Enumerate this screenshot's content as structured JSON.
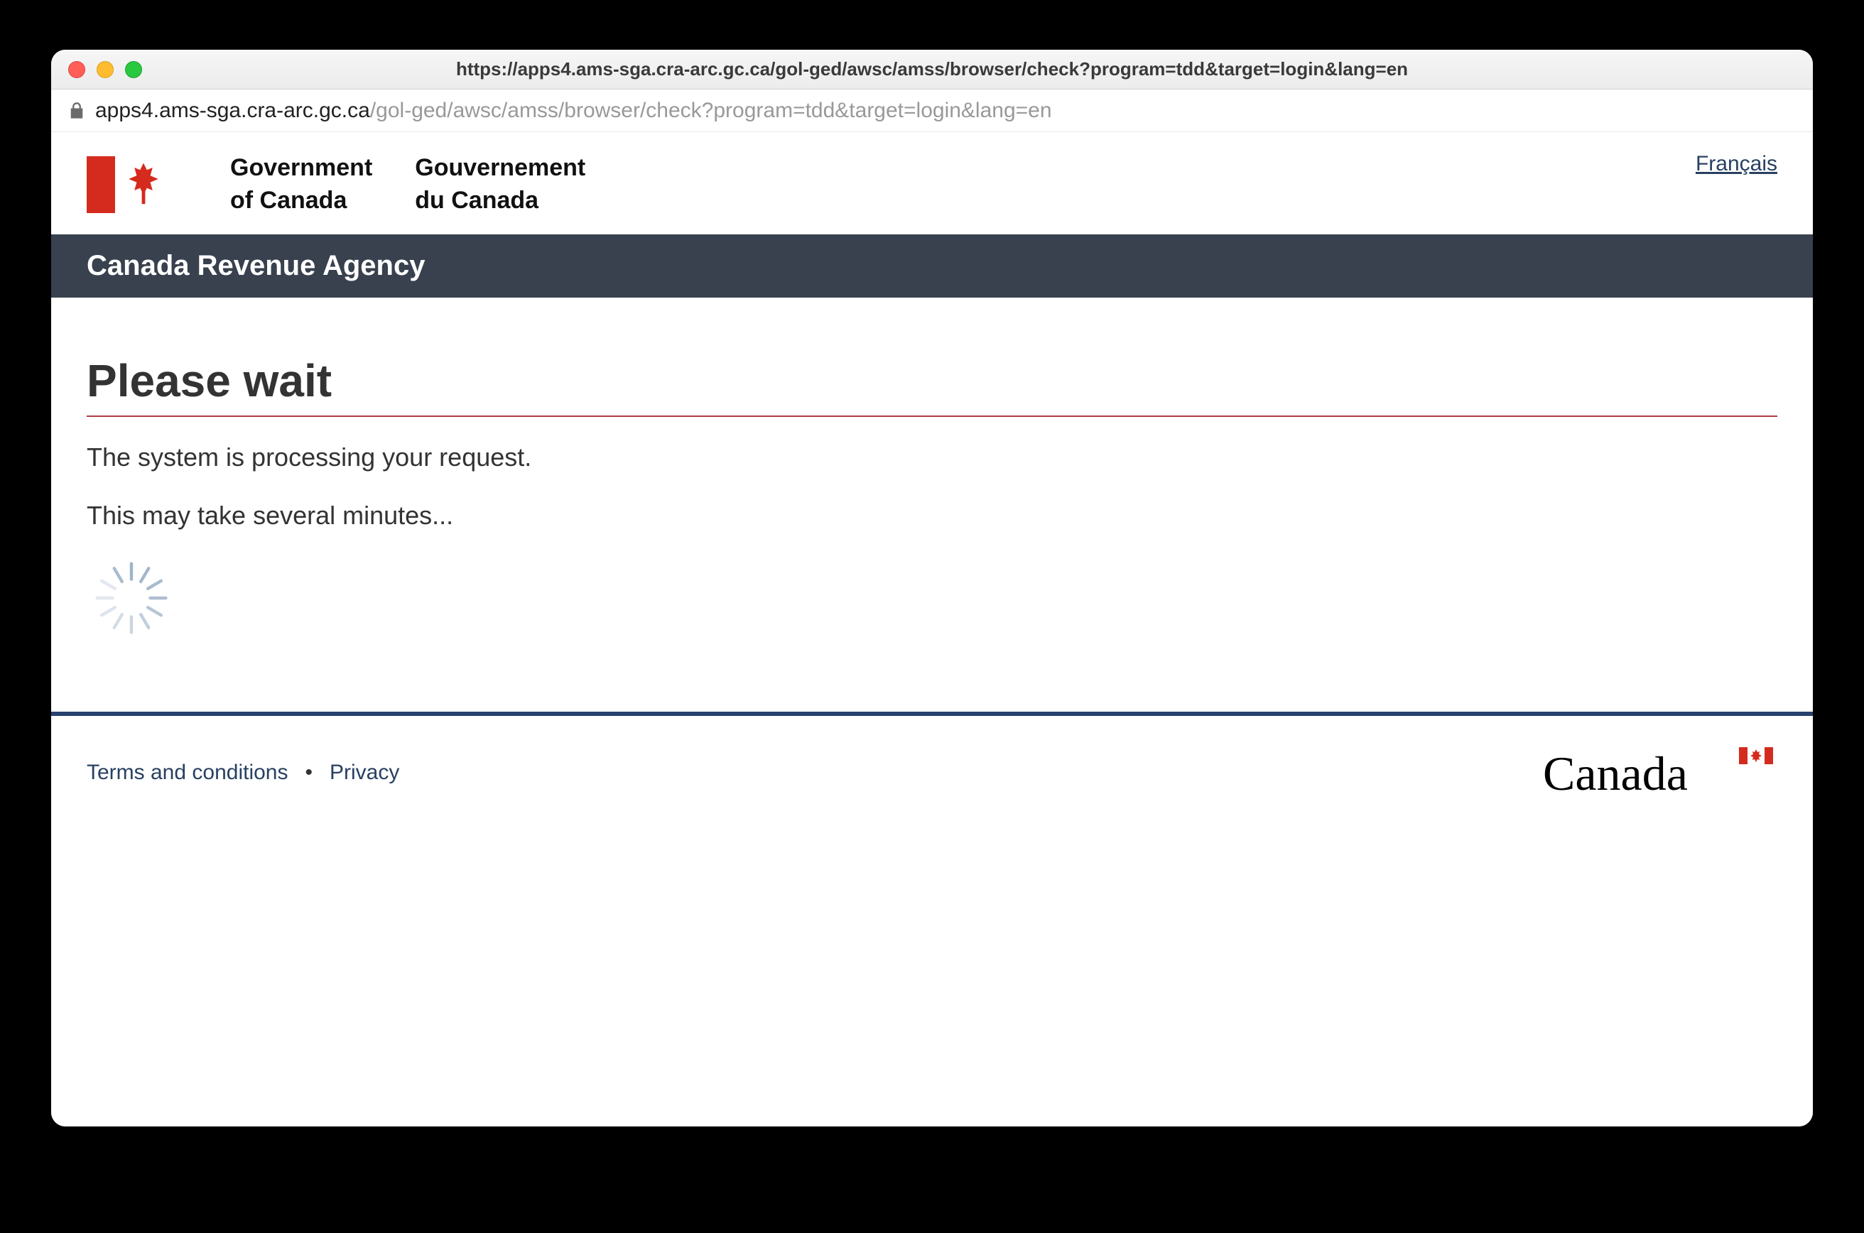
{
  "browser": {
    "title_url": "https://apps4.ams-sga.cra-arc.gc.ca/gol-ged/awsc/amss/browser/check?program=tdd&target=login&lang=en",
    "address_host": "apps4.ams-sga.cra-arc.gc.ca",
    "address_path": "/gol-ged/awsc/amss/browser/check?program=tdd&target=login&lang=en"
  },
  "header": {
    "gov_en_line1": "Government",
    "gov_en_line2": "of Canada",
    "gov_fr_line1": "Gouvernement",
    "gov_fr_line2": "du Canada",
    "lang_toggle": "Français",
    "agency": "Canada Revenue Agency"
  },
  "content": {
    "heading": "Please wait",
    "line1": "The system is processing your request.",
    "line2": "This may take several minutes..."
  },
  "footer": {
    "terms": "Terms and conditions",
    "privacy": "Privacy",
    "wordmark": "Canada"
  }
}
